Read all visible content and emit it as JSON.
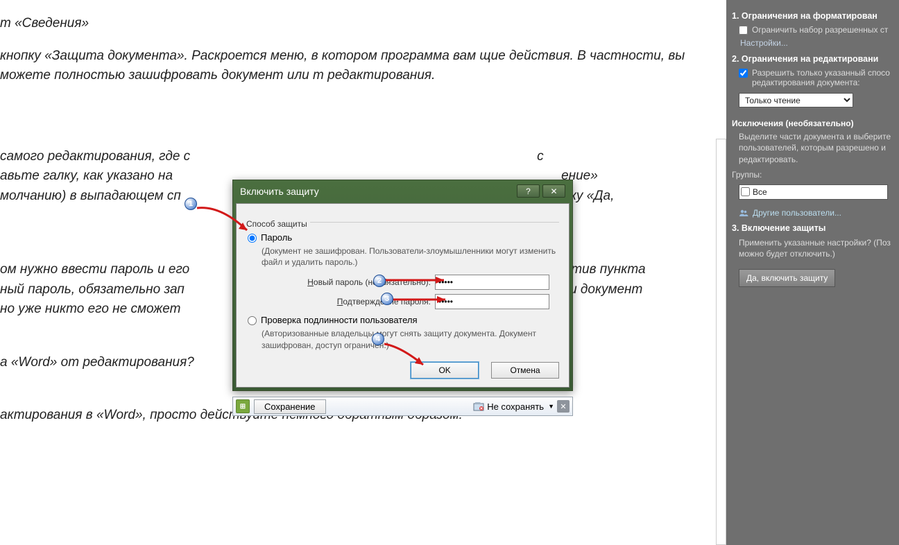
{
  "doc": {
    "p1": "т «Сведения»",
    "p2": " кнопку «Защита документа». Раскроется меню, в котором программа вам щие действия. В частности, вы можете полностью зашифровать документ или т редактирования.",
    "p3_a": "самого редактирования, где с",
    "p3_b": "авьте галку, как указано на",
    "p3_c": "ение»",
    "p3_d": "молчанию) в выпадающем сп",
    "p3_e": "опку «Да,",
    "p5": "ом нужно ввести пароль и его",
    "p5b": "тив пункта",
    "p6": "ный пароль, обязательно зап",
    "p6b": "ш документ",
    "p7": "но уже никто его не сможет",
    "p8": "а «Word» от редактирования?",
    "p9": "актирования в «Word», просто действуйте немного обратным образом:"
  },
  "dialog": {
    "title": "Включить защиту",
    "group": "Способ защиты",
    "radio_pw": "Пароль",
    "pw_hint": "(Документ не зашифрован. Пользователи-злоумышленники могут изменить файл и удалить пароль.)",
    "new_pw_label": "Новый пароль (необязательно):",
    "confirm_label": "Подтверждение пароля:",
    "new_pw_value": "●●●●●",
    "confirm_value": "●●●●●",
    "radio_auth": "Проверка подлинности пользователя",
    "auth_hint": "(Авторизованные владельцы могут снять защиту документа. Документ зашифрован, доступ ограничен.)",
    "ok": "OK",
    "cancel": "Отмена"
  },
  "savebar": {
    "save": "Сохранение",
    "dont_save": "Не сохранять"
  },
  "panel": {
    "s1": "1. Ограничения на форматирован",
    "s1_check": "Ограничить набор разрешенных ст",
    "s1_link": "Настройки...",
    "s2": "2. Ограничения на редактировани",
    "s2_check": "Разрешить только указанный спосо редактирования документа:",
    "s2_select": "Только чтение",
    "exc_h": "Исключения (необязательно)",
    "exc_desc": "Выделите части документа и выберите пользователей, которым разрешено и редактировать.",
    "groups_label": "Группы:",
    "group_all": "Все",
    "more_users": "Другие пользователи...",
    "s3": "3. Включение защиты",
    "s3_desc": "Применить указанные настройки? (Поз можно будет отключить.)",
    "s3_btn": "Да, включить защиту"
  },
  "callouts": {
    "c1": "1",
    "c2": "2",
    "c3": "3",
    "c4": "4"
  }
}
